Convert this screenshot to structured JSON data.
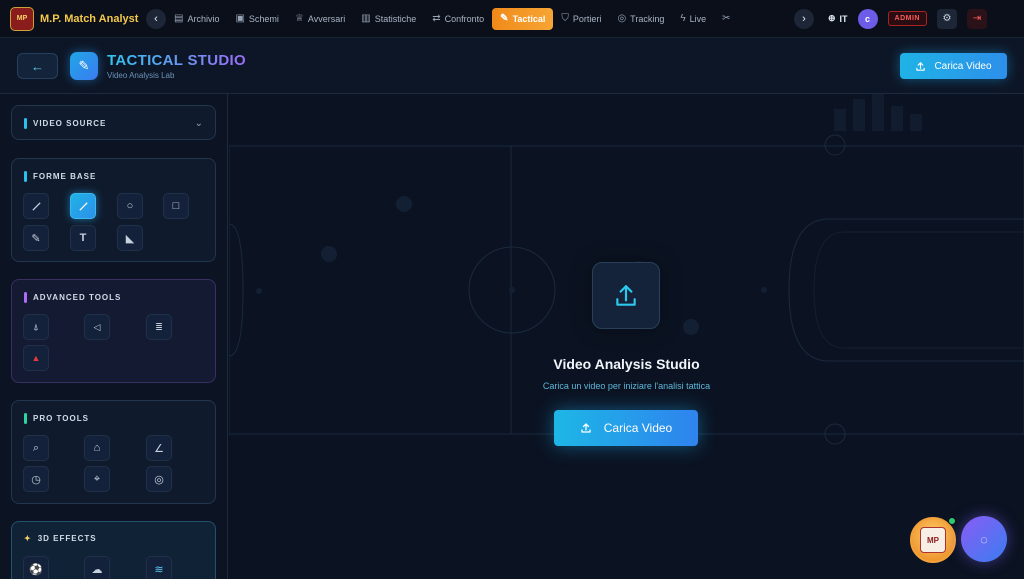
{
  "brand": {
    "logo_text": "MP",
    "name": "M.P. Match Analyst"
  },
  "nav": {
    "items": [
      {
        "label": "Archivio",
        "icon": "archive-icon",
        "glyph": "▤"
      },
      {
        "label": "Schemi",
        "icon": "board-icon",
        "glyph": "▣"
      },
      {
        "label": "Avversari",
        "icon": "trophy-icon",
        "glyph": "♕"
      },
      {
        "label": "Statistiche",
        "icon": "bar-chart-icon",
        "glyph": "▥"
      },
      {
        "label": "Confronto",
        "icon": "compare-icon",
        "glyph": "⇄"
      },
      {
        "label": "Tactical",
        "icon": "edit-icon",
        "glyph": "✎",
        "active": true
      },
      {
        "label": "Portieri",
        "icon": "shield-icon",
        "glyph": "⛉"
      },
      {
        "label": "Tracking",
        "icon": "target-icon",
        "glyph": "◎"
      },
      {
        "label": "Live",
        "icon": "lightning-icon",
        "glyph": "ϟ"
      }
    ],
    "language": "IT",
    "user_initial": "c",
    "admin_label": "ADMIN"
  },
  "header": {
    "title": "TACTICAL STUDIO",
    "subtitle": "Video Analysis Lab",
    "upload_button": "Carica Video"
  },
  "sidebar": {
    "video_source": {
      "title": "VIDEO SOURCE"
    },
    "forme_base": {
      "title": "FORME BASE",
      "tools": [
        "line-tool-icon",
        "arrow-tool-icon",
        "circle-tool-icon",
        "rectangle-tool-icon",
        "pencil-tool-icon",
        "text-tool-icon",
        "zone-tool-icon"
      ]
    },
    "advanced_tools": {
      "title": "ADVANCED TOOLS",
      "tools": [
        "player-tool-icon",
        "pass-tool-icon",
        "formation-tool-icon",
        "cone-tool-icon"
      ]
    },
    "pro_tools": {
      "title": "PRO TOOLS",
      "tools": [
        "zoom-tool-icon",
        "spotlight-tool-icon",
        "angle-tool-icon",
        "timer-tool-icon",
        "marker-tool-icon",
        "radar-tool-icon"
      ]
    },
    "effects_3d": {
      "title": "3D EFFECTS",
      "tools": [
        "ball-effect-icon",
        "smoke-effect-icon",
        "wave-effect-icon"
      ]
    }
  },
  "main": {
    "title": "Video Analysis Studio",
    "subtitle": "Carica un video per iniziare l'analisi tattica",
    "upload_button": "Carica Video"
  },
  "colors": {
    "accent_cyan": "#1fb3e6",
    "accent_orange": "#f08a1a",
    "brand_gold": "#f4c84a",
    "admin_red": "#ff5a5a"
  }
}
